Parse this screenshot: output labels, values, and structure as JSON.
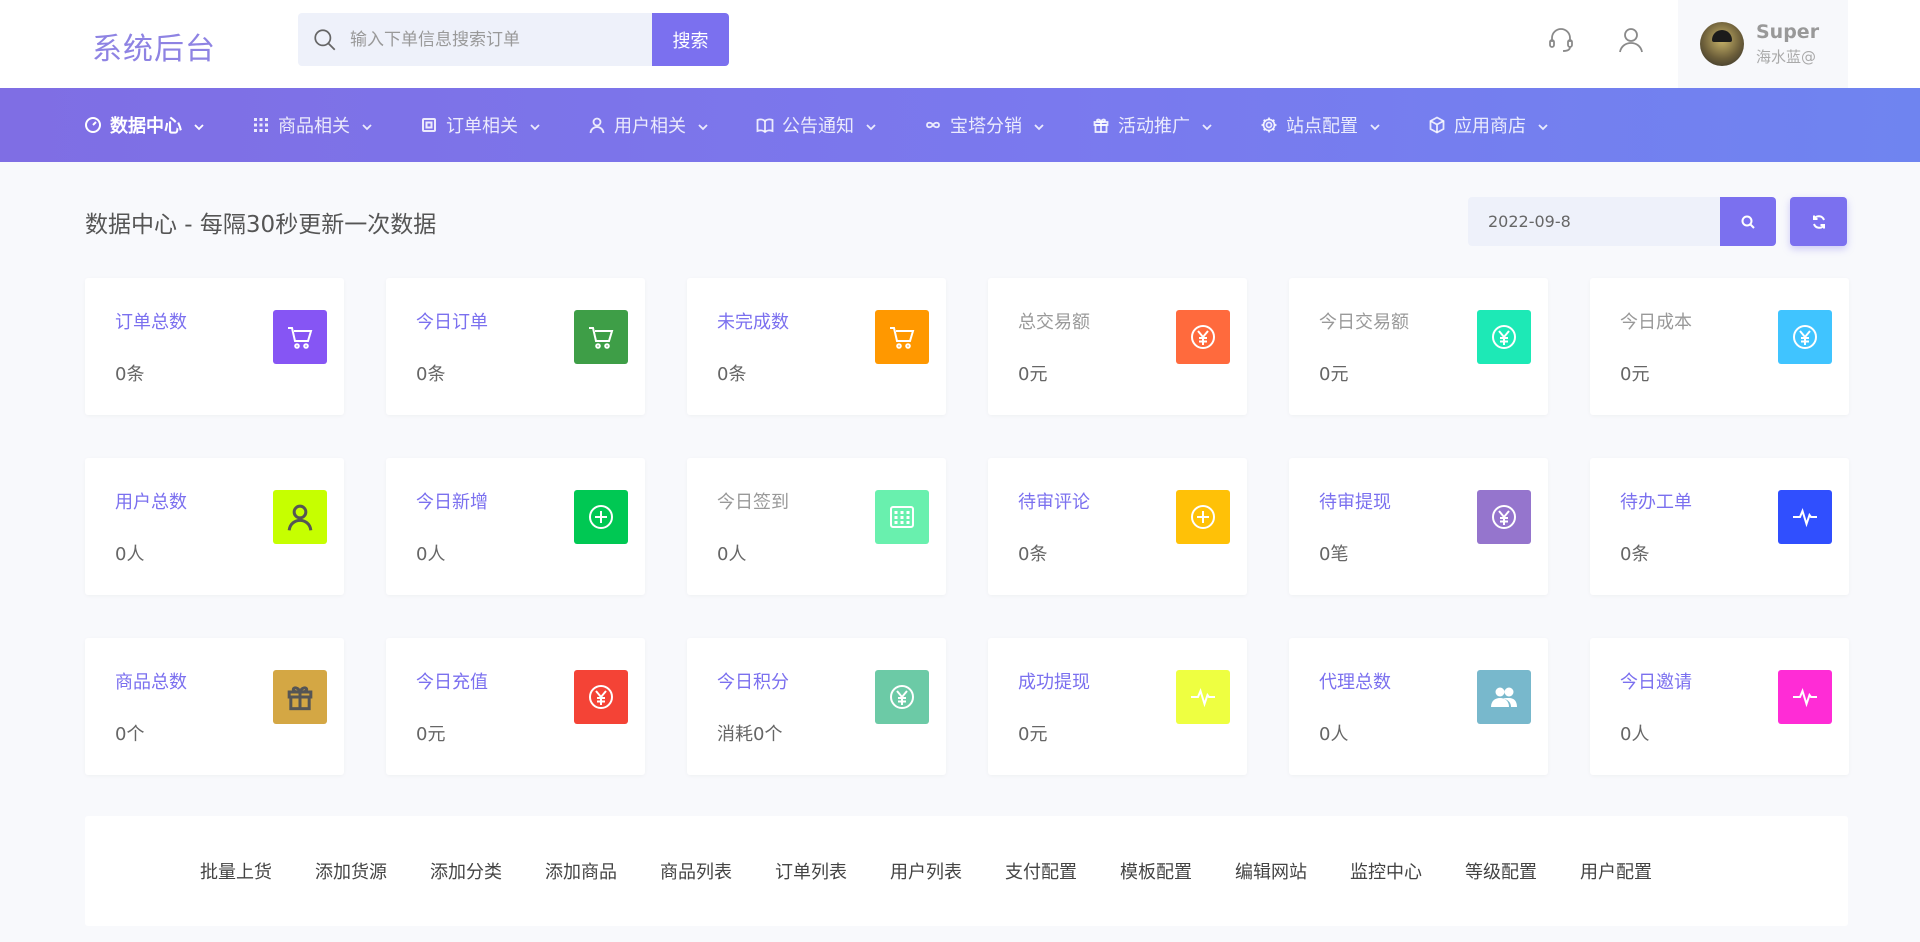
{
  "header": {
    "brand": "系统后台",
    "search_placeholder": "输入下单信息搜索订单",
    "search_button": "搜索",
    "user": {
      "name": "Super",
      "subtitle": "海水蓝@"
    }
  },
  "nav": [
    {
      "label": "数据中心",
      "icon": "dashboard-icon",
      "active": true
    },
    {
      "label": "商品相关",
      "icon": "grid-icon"
    },
    {
      "label": "订单相关",
      "icon": "order-icon"
    },
    {
      "label": "用户相关",
      "icon": "user-icon"
    },
    {
      "label": "公告通知",
      "icon": "book-icon"
    },
    {
      "label": "宝塔分销",
      "icon": "infinity-icon"
    },
    {
      "label": "活动推广",
      "icon": "gift-icon"
    },
    {
      "label": "站点配置",
      "icon": "gear-icon"
    },
    {
      "label": "应用商店",
      "icon": "box-icon"
    }
  ],
  "page": {
    "title": "数据中心 - 每隔30秒更新一次数据",
    "date_value": "2022-09-8"
  },
  "cards": [
    {
      "label": "订单总数",
      "value": "0条",
      "label_color": "#7b70ef",
      "icon": "cart-icon",
      "bg": "#8655f4"
    },
    {
      "label": "今日订单",
      "value": "0条",
      "label_color": "#7b70ef",
      "icon": "cart-icon",
      "bg": "#3e9e47"
    },
    {
      "label": "未完成数",
      "value": "0条",
      "label_color": "#7b70ef",
      "icon": "cart-icon",
      "bg": "#ff9800"
    },
    {
      "label": "总交易额",
      "value": "0元",
      "label_color": "#999999",
      "icon": "yen-icon",
      "bg": "#ff6a3d"
    },
    {
      "label": "今日交易额",
      "value": "0元",
      "label_color": "#999999",
      "icon": "yen-icon",
      "bg": "#1de9b6"
    },
    {
      "label": "今日成本",
      "value": "0元",
      "label_color": "#999999",
      "icon": "yen-icon",
      "bg": "#40c4ff"
    },
    {
      "label": "用户总数",
      "value": "0人",
      "label_color": "#7b70ef",
      "icon": "user-icon",
      "bg": "#c6ff00"
    },
    {
      "label": "今日新增",
      "value": "0人",
      "label_color": "#7b70ef",
      "icon": "plus-circle-icon",
      "bg": "#00c853"
    },
    {
      "label": "今日签到",
      "value": "0人",
      "label_color": "#999999",
      "icon": "calendar-icon",
      "bg": "#69f0ae"
    },
    {
      "label": "待审评论",
      "value": "0条",
      "label_color": "#7b70ef",
      "icon": "plus-circle-icon",
      "bg": "#ffc107"
    },
    {
      "label": "待审提现",
      "value": "0笔",
      "label_color": "#7b70ef",
      "icon": "yen-icon",
      "bg": "#9575cd"
    },
    {
      "label": "待办工单",
      "value": "0条",
      "label_color": "#7b70ef",
      "icon": "pulse-icon",
      "bg": "#304ffe"
    },
    {
      "label": "商品总数",
      "value": "0个",
      "label_color": "#7b70ef",
      "icon": "gift-icon",
      "bg": "#d4a744"
    },
    {
      "label": "今日充值",
      "value": "0元",
      "label_color": "#7b70ef",
      "icon": "yen-icon",
      "bg": "#f44336"
    },
    {
      "label": "今日积分",
      "value": "消耗0个",
      "label_color": "#7b70ef",
      "icon": "yen-icon",
      "bg": "#6ccaa6"
    },
    {
      "label": "成功提现",
      "value": "0元",
      "label_color": "#7b70ef",
      "icon": "pulse-icon",
      "bg": "#eeff41"
    },
    {
      "label": "代理总数",
      "value": "0人",
      "label_color": "#7b70ef",
      "icon": "users-icon",
      "bg": "#78b8cc"
    },
    {
      "label": "今日邀请",
      "value": "0人",
      "label_color": "#7b70ef",
      "icon": "pulse-icon",
      "bg": "#ff2cd6"
    }
  ],
  "quick_links": [
    "批量上货",
    "添加货源",
    "添加分类",
    "添加商品",
    "商品列表",
    "订单列表",
    "用户列表",
    "支付配置",
    "模板配置",
    "编辑网站",
    "监控中心",
    "等级配置",
    "用户配置"
  ]
}
